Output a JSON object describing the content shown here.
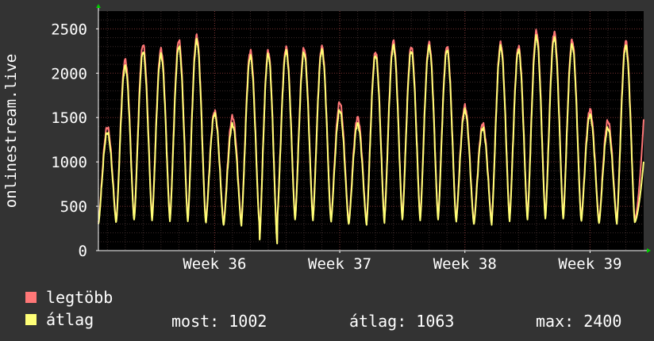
{
  "chart_data": {
    "type": "line",
    "ylabel": "onlinestream.live",
    "ylim": [
      0,
      2700
    ],
    "y_ticks": [
      0,
      500,
      1000,
      1500,
      2000,
      2500
    ],
    "x_tick_labels": [
      "Week 36",
      "Week 37",
      "Week 38",
      "Week 39"
    ],
    "x_tick_days": [
      6.5,
      13.5,
      20.5,
      27.5
    ],
    "days": 30.5,
    "grid": true,
    "legend_position": "bottom-left",
    "series": [
      {
        "name": "legtöbb",
        "color": "#ff7777",
        "daily": [
          {
            "peak": 1390,
            "trough": 320
          },
          {
            "peak": 2150,
            "trough": 340
          },
          {
            "peak": 2320,
            "trough": 370
          },
          {
            "peak": 2270,
            "trough": 360
          },
          {
            "peak": 2370,
            "trough": 350
          },
          {
            "peak": 2420,
            "trough": 350
          },
          {
            "peak": 1570,
            "trough": 310
          },
          {
            "peak": 1510,
            "trough": 300
          },
          {
            "peak": 2250,
            "trough": 330
          },
          {
            "peak": 2250,
            "trough": 90
          },
          {
            "peak": 2290,
            "trough": 370
          },
          {
            "peak": 2280,
            "trough": 360
          },
          {
            "peak": 2300,
            "trough": 370
          },
          {
            "peak": 1670,
            "trough": 320
          },
          {
            "peak": 1500,
            "trough": 310
          },
          {
            "peak": 2240,
            "trough": 330
          },
          {
            "peak": 2360,
            "trough": 370
          },
          {
            "peak": 2300,
            "trough": 360
          },
          {
            "peak": 2340,
            "trough": 370
          },
          {
            "peak": 2300,
            "trough": 370
          },
          {
            "peak": 1630,
            "trough": 320
          },
          {
            "peak": 1430,
            "trough": 310
          },
          {
            "peak": 2340,
            "trough": 350
          },
          {
            "peak": 2300,
            "trough": 370
          },
          {
            "peak": 2470,
            "trough": 380
          },
          {
            "peak": 2460,
            "trough": 380
          },
          {
            "peak": 2370,
            "trough": 370
          },
          {
            "peak": 1590,
            "trough": 330
          },
          {
            "peak": 1460,
            "trough": 320
          },
          {
            "peak": 2360,
            "trough": 340
          }
        ],
        "end_value": 1480
      },
      {
        "name": "átlag",
        "color": "#ffff77",
        "daily": [
          {
            "peak": 1330,
            "trough": 300
          },
          {
            "peak": 2080,
            "trough": 330
          },
          {
            "peak": 2240,
            "trough": 350
          },
          {
            "peak": 2210,
            "trough": 340
          },
          {
            "peak": 2300,
            "trough": 330
          },
          {
            "peak": 2370,
            "trough": 330
          },
          {
            "peak": 1540,
            "trough": 290
          },
          {
            "peak": 1420,
            "trough": 280
          },
          {
            "peak": 2190,
            "trough": 310
          },
          {
            "peak": 2210,
            "trough": 80
          },
          {
            "peak": 2250,
            "trough": 350
          },
          {
            "peak": 2230,
            "trough": 340
          },
          {
            "peak": 2260,
            "trough": 350
          },
          {
            "peak": 1580,
            "trough": 300
          },
          {
            "peak": 1430,
            "trough": 290
          },
          {
            "peak": 2200,
            "trough": 310
          },
          {
            "peak": 2310,
            "trough": 350
          },
          {
            "peak": 2250,
            "trough": 340
          },
          {
            "peak": 2300,
            "trough": 350
          },
          {
            "peak": 2260,
            "trough": 350
          },
          {
            "peak": 1580,
            "trough": 300
          },
          {
            "peak": 1380,
            "trough": 290
          },
          {
            "peak": 2300,
            "trough": 330
          },
          {
            "peak": 2260,
            "trough": 350
          },
          {
            "peak": 2410,
            "trough": 360
          },
          {
            "peak": 2400,
            "trough": 360
          },
          {
            "peak": 2320,
            "trough": 350
          },
          {
            "peak": 1530,
            "trough": 310
          },
          {
            "peak": 1380,
            "trough": 300
          },
          {
            "peak": 2310,
            "trough": 320
          }
        ],
        "end_value": 1002
      }
    ]
  },
  "legend": {
    "max_label": "legtöbb",
    "avg_label": "átlag",
    "max_color": "#ff7777",
    "avg_color": "#ffff77"
  },
  "stats": {
    "now": "most: 1002",
    "avg": "átlag: 1063",
    "max": "max: 2400"
  }
}
